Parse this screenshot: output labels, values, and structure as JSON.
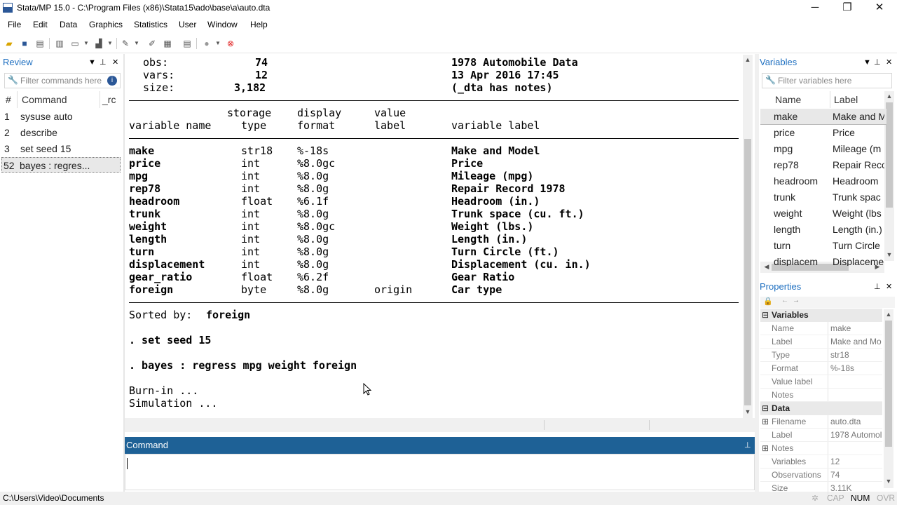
{
  "window": {
    "title": "Stata/MP 15.0 - C:\\Program Files (x86)\\Stata15\\ado\\base\\a\\auto.dta",
    "minimize": "─",
    "restore": "❐",
    "close": "✕"
  },
  "menu": [
    "File",
    "Edit",
    "Data",
    "Graphics",
    "Statistics",
    "User",
    "Window",
    "Help"
  ],
  "review": {
    "title": "Review",
    "filter_placeholder": "Filter commands here",
    "col_num": "#",
    "col_command": "Command",
    "col_rc": "_rc",
    "rows": [
      {
        "num": "1",
        "command": "sysuse auto"
      },
      {
        "num": "2",
        "command": "describe"
      },
      {
        "num": "3",
        "command": "set seed 15"
      },
      {
        "num": "52",
        "command": "bayes : regres..."
      }
    ]
  },
  "results": {
    "obs_label": "obs:",
    "obs_value": "74",
    "vars_label": "vars:",
    "vars_value": "12",
    "size_label": "size:",
    "size_value": "3,182",
    "dataset_label": "1978 Automobile Data",
    "dataset_date": "13 Apr 2016 17:45",
    "dataset_notes": "(_dta has notes)",
    "hdr1_storage": "storage",
    "hdr1_display": "display",
    "hdr1_value": "value",
    "hdr2_varname": "variable name",
    "hdr2_type": "type",
    "hdr2_format": "format",
    "hdr2_label": "label",
    "hdr2_varlabel": "variable label",
    "vars": [
      {
        "name": "make",
        "type": "str18",
        "format": "%-18s",
        "vlabel": "",
        "label": "Make and Model"
      },
      {
        "name": "price",
        "type": "int",
        "format": "%8.0gc",
        "vlabel": "",
        "label": "Price"
      },
      {
        "name": "mpg",
        "type": "int",
        "format": "%8.0g",
        "vlabel": "",
        "label": "Mileage (mpg)"
      },
      {
        "name": "rep78",
        "type": "int",
        "format": "%8.0g",
        "vlabel": "",
        "label": "Repair Record 1978"
      },
      {
        "name": "headroom",
        "type": "float",
        "format": "%6.1f",
        "vlabel": "",
        "label": "Headroom (in.)"
      },
      {
        "name": "trunk",
        "type": "int",
        "format": "%8.0g",
        "vlabel": "",
        "label": "Trunk space (cu. ft.)"
      },
      {
        "name": "weight",
        "type": "int",
        "format": "%8.0gc",
        "vlabel": "",
        "label": "Weight (lbs.)"
      },
      {
        "name": "length",
        "type": "int",
        "format": "%8.0g",
        "vlabel": "",
        "label": "Length (in.)"
      },
      {
        "name": "turn",
        "type": "int",
        "format": "%8.0g",
        "vlabel": "",
        "label": "Turn Circle (ft.)"
      },
      {
        "name": "displacement",
        "type": "int",
        "format": "%8.0g",
        "vlabel": "",
        "label": "Displacement (cu. in.)"
      },
      {
        "name": "gear_ratio",
        "type": "float",
        "format": "%6.2f",
        "vlabel": "",
        "label": "Gear Ratio"
      },
      {
        "name": "foreign",
        "type": "byte",
        "format": "%8.0g",
        "vlabel": "origin",
        "label": "Car type"
      }
    ],
    "sorted_label": "Sorted by:",
    "sorted_value": "foreign",
    "cmd1": ". set seed 15",
    "cmd2": ". bayes : regress mpg weight foreign",
    "burnin": "Burn-in ...",
    "simulation": "Simulation ..."
  },
  "command": {
    "title": "Command",
    "value": ""
  },
  "variables": {
    "title": "Variables",
    "filter_placeholder": "Filter variables here",
    "col_name": "Name",
    "col_label": "Label",
    "rows": [
      {
        "name": "make",
        "label": "Make and M"
      },
      {
        "name": "price",
        "label": "Price"
      },
      {
        "name": "mpg",
        "label": "Mileage (m"
      },
      {
        "name": "rep78",
        "label": "Repair Reco"
      },
      {
        "name": "headroom",
        "label": "Headroom"
      },
      {
        "name": "trunk",
        "label": "Trunk spac"
      },
      {
        "name": "weight",
        "label": "Weight (lbs"
      },
      {
        "name": "length",
        "label": "Length (in.)"
      },
      {
        "name": "turn",
        "label": "Turn Circle"
      },
      {
        "name": "displacem",
        "label": "Displaceme"
      }
    ]
  },
  "properties": {
    "title": "Properties",
    "group_variables": "Variables",
    "var_props": [
      {
        "key": "Name",
        "value": "make"
      },
      {
        "key": "Label",
        "value": "Make and Mo"
      },
      {
        "key": "Type",
        "value": "str18"
      },
      {
        "key": "Format",
        "value": "%-18s"
      },
      {
        "key": "Value label",
        "value": ""
      },
      {
        "key": "Notes",
        "value": ""
      }
    ],
    "group_data": "Data",
    "data_props": [
      {
        "key": "Filename",
        "value": "auto.dta"
      },
      {
        "key": "Label",
        "value": "1978 Automol"
      },
      {
        "key": "Notes",
        "value": ""
      },
      {
        "key": "Variables",
        "value": "12"
      },
      {
        "key": "Observations",
        "value": "74"
      },
      {
        "key": "Size",
        "value": "3.11K"
      }
    ]
  },
  "status": {
    "path": "C:\\Users\\Video\\Documents",
    "cap": "CAP",
    "num": "NUM",
    "ovr": "OVR"
  }
}
